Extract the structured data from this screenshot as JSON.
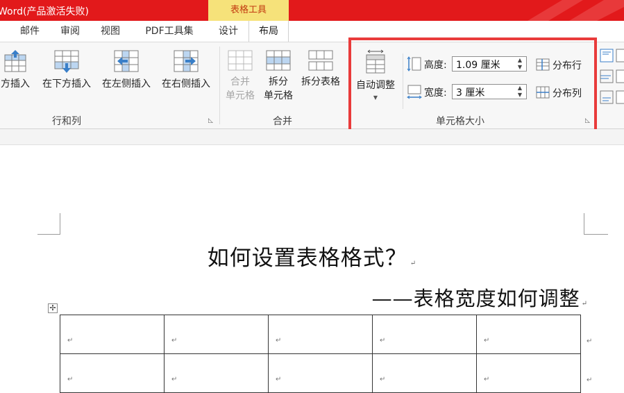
{
  "window": {
    "app_title": "Word(产品激活失败)",
    "contextual_tab": "表格工具"
  },
  "tabs": [
    {
      "label": "邮件"
    },
    {
      "label": "审阅"
    },
    {
      "label": "视图"
    },
    {
      "label": "PDF工具集"
    },
    {
      "label": "设计"
    },
    {
      "label": "布局",
      "active": true
    }
  ],
  "ribbon": {
    "rows_cols": {
      "label": "行和列",
      "buttons": [
        "方插入",
        "在下方插入",
        "在左侧插入",
        "在右侧插入"
      ]
    },
    "merge": {
      "label": "合并",
      "buttons": [
        {
          "line1": "合并",
          "line2": "单元格",
          "disabled": true
        },
        {
          "line1": "拆分",
          "line2": "单元格"
        },
        {
          "line1": "拆分表格",
          "line2": ""
        }
      ]
    },
    "cell_size": {
      "label": "单元格大小",
      "autofit_label": "自动调整",
      "height_label": "高度:",
      "height_value": "1.09 厘米",
      "width_label": "宽度:",
      "width_value": "3 厘米",
      "distribute_rows": "分布行",
      "distribute_cols": "分布列"
    }
  },
  "document": {
    "title": "如何设置表格格式？",
    "subtitle": "——表格宽度如何调整",
    "paragraph_mark": "↵",
    "table": {
      "columns": 5,
      "rows_visible": 2
    }
  },
  "colors": {
    "titlebar": "#e2191b",
    "contextual_tab": "#f6e27a",
    "highlight_box": "#e93b3b",
    "icon_blue": "#3a7fc8"
  }
}
